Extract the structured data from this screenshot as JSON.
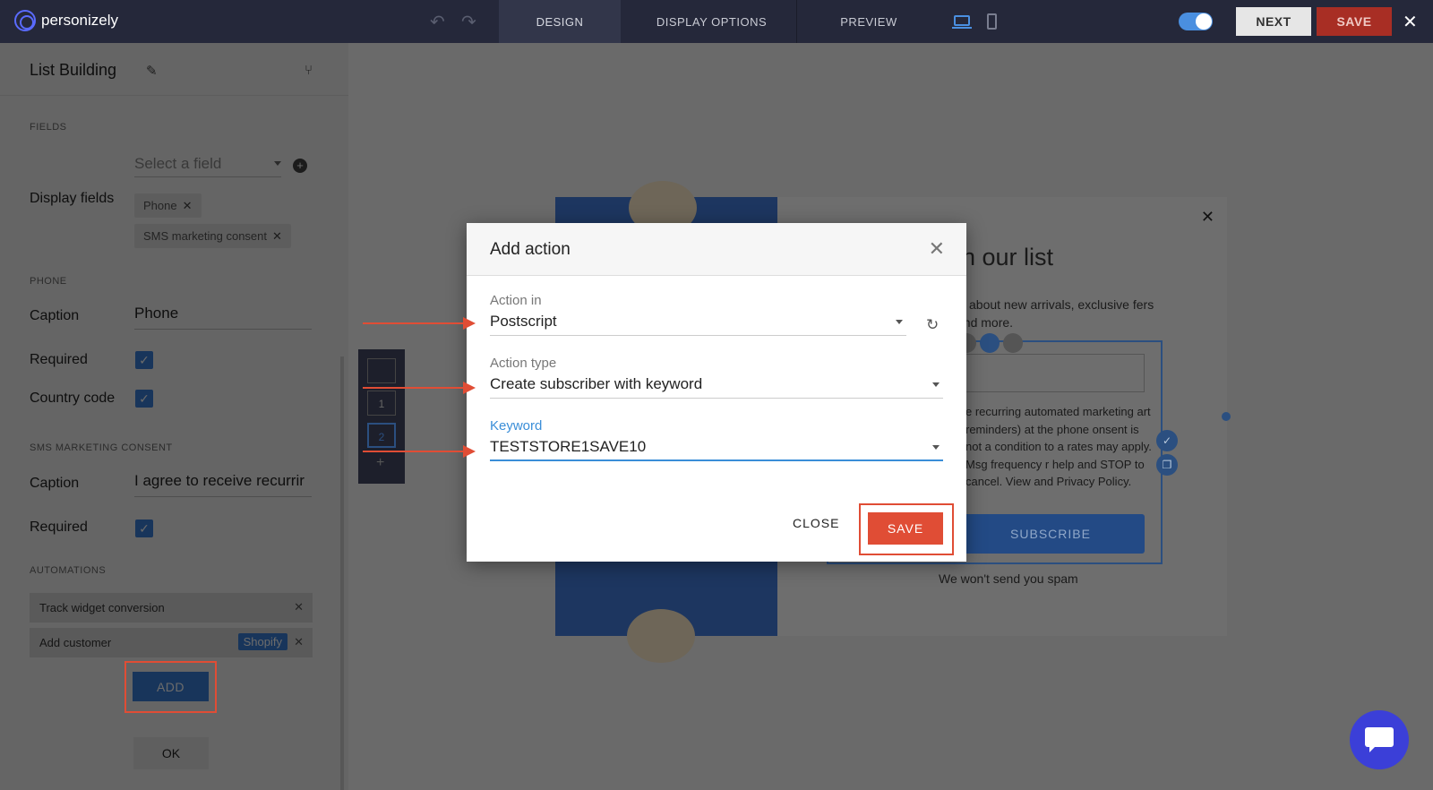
{
  "app": {
    "brand": "personizely"
  },
  "topbar": {
    "tabs": {
      "design": "DESIGN",
      "display": "DISPLAY OPTIONS",
      "preview": "PREVIEW"
    },
    "next_label": "NEXT",
    "save_label": "SAVE"
  },
  "panel": {
    "title": "List Building",
    "fields_section": "FIELDS",
    "select_field_placeholder": "Select a field",
    "display_fields_label": "Display fields",
    "display_chips": [
      "Phone",
      "SMS marketing consent"
    ],
    "phone_section": "PHONE",
    "caption_label": "Caption",
    "phone_caption_value": "Phone",
    "required_label": "Required",
    "country_code_label": "Country code",
    "sms_section": "SMS MARKETING CONSENT",
    "sms_caption_value": "I agree to receive recurrir",
    "automations_section": "AUTOMATIONS",
    "automations": [
      {
        "label": "Track widget conversion",
        "tag": ""
      },
      {
        "label": "Add customer",
        "tag": "Shopify"
      }
    ],
    "add_label": "ADD",
    "ok_label": "OK"
  },
  "canvas": {
    "nav_slots": [
      "",
      "1",
      "2"
    ],
    "widget": {
      "title_fragment": "in our list",
      "subtitle_fragment": "w about new arrivals, exclusive fers and more.",
      "consent_fragment": "e recurring automated marketing art reminders) at the phone onsent is not a condition to a rates may apply. Msg frequency r help and STOP to cancel. View and Privacy Policy.",
      "button_fragment": "SUBSCRIBE",
      "spam_text": "We won't send you spam"
    }
  },
  "dialog": {
    "title": "Add action",
    "action_in_label": "Action in",
    "action_in_value": "Postscript",
    "action_type_label": "Action type",
    "action_type_value": "Create subscriber with keyword",
    "keyword_label": "Keyword",
    "keyword_value": "TESTSTORE1SAVE10",
    "close_label": "CLOSE",
    "save_label": "SAVE"
  },
  "colors": {
    "topbar": "#25283a",
    "accent_blue": "#3a7ed8",
    "save_red": "#e04d35",
    "chat": "#3b3fd8"
  }
}
